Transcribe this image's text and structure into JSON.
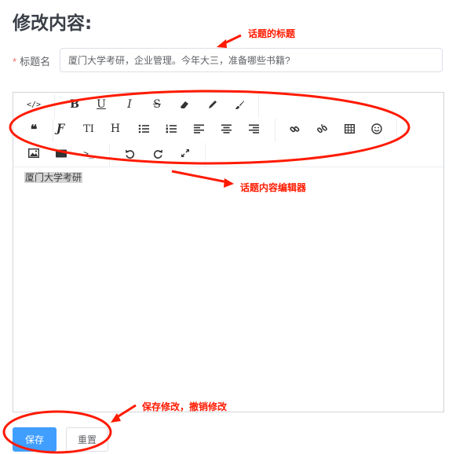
{
  "page": {
    "title": "修改内容:"
  },
  "form": {
    "title_label": "标题名",
    "required_mark": "*",
    "title_value": "厦门大学考研，企业管理。今年大三，准备哪些书籍?"
  },
  "editor": {
    "content_text": "厦门大学考研",
    "toolbar": [
      [
        "code-icon",
        "bold-icon",
        "underline-icon",
        "italic-icon",
        "strikethrough-icon",
        "eraser-icon",
        "pencil-icon",
        "brush-icon"
      ],
      [
        "quote-icon",
        "font-icon",
        "text-size-icon",
        "heading-icon",
        "bullet-list-icon",
        "numbered-list-icon",
        "align-left-icon",
        "align-center-icon",
        "align-right-icon",
        "link-icon",
        "unlink-icon",
        "table-icon",
        "emoji-icon"
      ],
      [
        "image-icon",
        "video-icon",
        "terminal-icon",
        "undo-icon",
        "redo-icon",
        "fullscreen-icon"
      ]
    ],
    "toolbar_glyphs": {
      "bold": "B",
      "underline": "U",
      "italic": "I",
      "strike": "S",
      "font": "Ƒ",
      "text_size": "TI",
      "heading": "H",
      "quote": "❝",
      "code": "</>",
      "terminal": ">_"
    }
  },
  "buttons": {
    "save_label": "保存",
    "reset_label": "重置"
  },
  "annotations": {
    "topic_title": "话题的标题",
    "topic_editor": "话题内容编辑器",
    "save_reset": "保存修改，撤销修改",
    "color": "#ff1a00"
  },
  "colors": {
    "primary": "#409eff",
    "required": "#f56c6c",
    "annotation": "#ff1a00"
  }
}
